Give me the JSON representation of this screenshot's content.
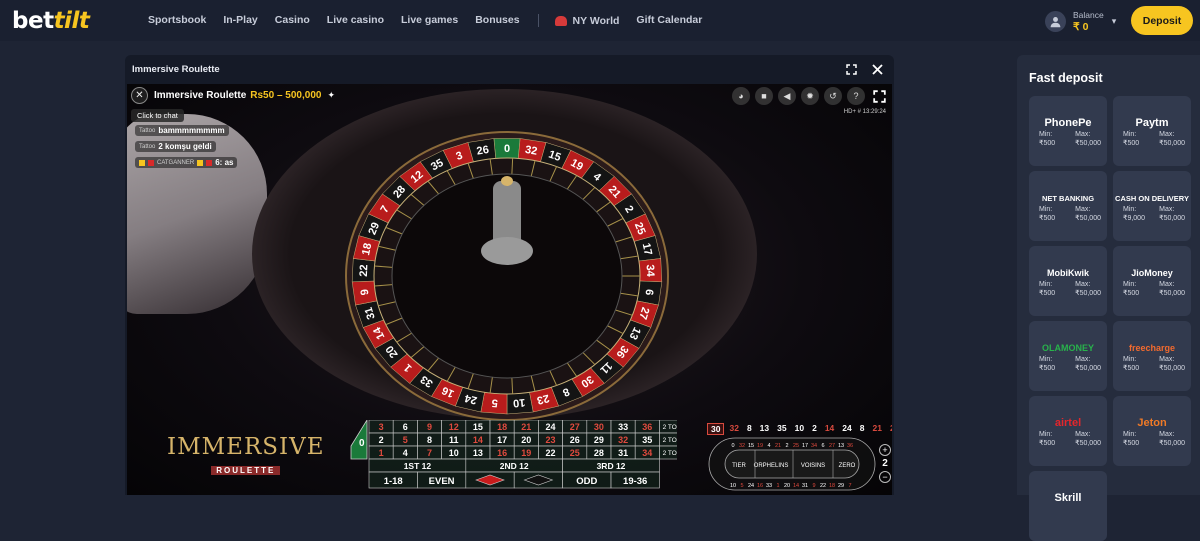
{
  "header": {
    "logo_prefix": "bet",
    "logo_suffix": "tilt",
    "nav": [
      "Sportsbook",
      "In-Play",
      "Casino",
      "Live casino",
      "Live games",
      "Bonuses"
    ],
    "promo": [
      "NY World",
      "Gift Calendar"
    ],
    "balance_label": "Balance",
    "balance_value": "₹ 0",
    "deposit_label": "Deposit"
  },
  "game": {
    "panel_title": "Immersive Roulette",
    "video_title": "Immersive Roulette",
    "limits": "Rs50 – 500,000",
    "chat_button": "Click to chat",
    "chat": [
      {
        "user": "Tattoo",
        "msg": "bammmmmmmm"
      },
      {
        "user": "Tattoo",
        "msg": "2 komşu geldi"
      },
      {
        "user": "CATGANNER",
        "msg": "6: as"
      }
    ],
    "hd_label": "HD+ # 13:29:24",
    "brand_main": "IMMERSIVE",
    "brand_sub": "ROULETTE",
    "wheel_numbers": [
      "0",
      "32",
      "15",
      "19",
      "4",
      "21",
      "2",
      "25",
      "17",
      "34",
      "6",
      "27",
      "13",
      "36",
      "11",
      "30",
      "8",
      "23",
      "10",
      "5",
      "24",
      "16",
      "33",
      "1",
      "20",
      "14",
      "31",
      "9",
      "22",
      "18",
      "29",
      "7",
      "28",
      "12",
      "35",
      "3",
      "26"
    ],
    "history": [
      "30",
      "32",
      "8",
      "13",
      "35",
      "10",
      "2",
      "14",
      "24",
      "8",
      "21",
      "21"
    ],
    "table": {
      "zero": "0",
      "rows": [
        [
          "3",
          "6",
          "9",
          "12",
          "15",
          "18",
          "21",
          "24",
          "27",
          "30",
          "33",
          "36"
        ],
        [
          "2",
          "5",
          "8",
          "11",
          "14",
          "17",
          "20",
          "23",
          "26",
          "29",
          "32",
          "35"
        ],
        [
          "1",
          "4",
          "7",
          "10",
          "13",
          "16",
          "19",
          "22",
          "25",
          "28",
          "31",
          "34"
        ]
      ],
      "col_label": "2 TO 1",
      "dozens": [
        "1ST 12",
        "2ND 12",
        "3RD 12"
      ],
      "outside": [
        "1-18",
        "EVEN",
        "",
        "",
        "ODD",
        "19-36"
      ]
    },
    "racetrack_labels": [
      "TIER",
      "ORPHELINS",
      "VOISINS",
      "ZERO"
    ],
    "racetrack_neighbour": "2"
  },
  "sidebar": {
    "title": "Fast deposit",
    "min_label": "Min:",
    "max_label": "Max:",
    "methods": [
      {
        "name": "PhonePe",
        "min": "₹500",
        "max": "₹50,000",
        "color": "#ffffff"
      },
      {
        "name": "Paytm",
        "min": "₹500",
        "max": "₹50,000",
        "color": "#ffffff"
      },
      {
        "name": "NET BANKING",
        "min": "₹500",
        "max": "₹50,000",
        "color": "#ffffff"
      },
      {
        "name": "CASH ON DELIVERY",
        "min": "₹9,000",
        "max": "₹50,000",
        "color": "#ffffff"
      },
      {
        "name": "MobiKwik",
        "min": "₹500",
        "max": "₹50,000",
        "color": "#ffffff"
      },
      {
        "name": "JioMoney",
        "min": "₹500",
        "max": "₹50,000",
        "color": "#ffffff"
      },
      {
        "name": "OLAMONEY",
        "min": "₹500",
        "max": "₹50,000",
        "color": "#28b24b"
      },
      {
        "name": "freecharge",
        "min": "₹500",
        "max": "₹50,000",
        "color": "#f26a2e"
      },
      {
        "name": "airtel",
        "min": "₹500",
        "max": "₹50,000",
        "color": "#e4262c"
      },
      {
        "name": "Jeton",
        "min": "₹500",
        "max": "₹50,000",
        "color": "#f07a27"
      },
      {
        "name": "Skrill",
        "min": "",
        "max": "",
        "color": "#ffffff"
      }
    ]
  }
}
